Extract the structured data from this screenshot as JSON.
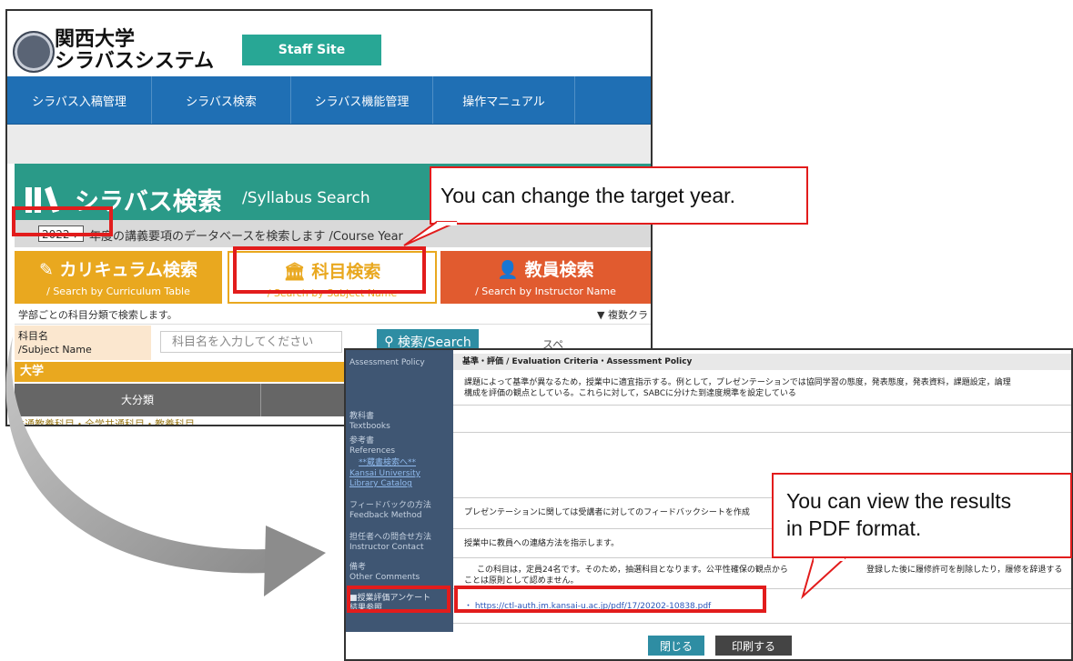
{
  "system": {
    "logo_line1": "関西大学",
    "logo_line2": "シラバスシステム",
    "staff_site_label": "Staff Site"
  },
  "nav": {
    "items": [
      {
        "label": "シラバス入稿管理"
      },
      {
        "label": "シラバス検索"
      },
      {
        "label": "シラバス機能管理"
      },
      {
        "label": "操作マニュアル"
      }
    ]
  },
  "header": {
    "title_jp": "シラバス検索",
    "title_en": "/Syllabus Search"
  },
  "year": {
    "selected": "2022",
    "caption": "年度の講義要項のデータベースを検索します /Course Year"
  },
  "tabs": [
    {
      "jp": "カリキュラム検索",
      "en": "/ Search by Curriculum Table"
    },
    {
      "jp": "科目検索",
      "en": "/ Search by Subject Name"
    },
    {
      "jp": "教員検索",
      "en": "/ Search by Instructor Name"
    }
  ],
  "search": {
    "description": "学部ごとの科目分類で検索します。",
    "multi_class_label": "▼ 複数クラ",
    "subject_label_jp": "科目名",
    "subject_label_en": "/Subject Name",
    "placeholder": "科目名を入力してください",
    "button_label": "検索/Search",
    "trailing_text": "スペ"
  },
  "results": {
    "section": "大学",
    "column_header": "大分類",
    "first_row": "共通教養科目・全学共通科目・教養科目"
  },
  "detail": {
    "rows": [
      {
        "left": "Assessment Policy",
        "right": ""
      },
      {
        "left": "教科書\nTextbooks",
        "right": ""
      },
      {
        "left": "参考書\nReferences",
        "right": ""
      },
      {
        "left": "フィードバックの方法\nFeedback Method",
        "right": "プレゼンテーションに関しては受講者に対してのフィードバックシートを作成"
      },
      {
        "left": "担任者への問合せ方法\nInstructor Contact",
        "right": "授業中に教員への連絡方法を指示します。"
      },
      {
        "left": "備考\nOther Comments",
        "right": ""
      },
      {
        "left": "■授業評価アンケート\n結果参照",
        "right": ""
      }
    ],
    "criteria_header": "基準・評価 / Evaluation Criteria・Assessment Policy",
    "criteria_text1": "課題によって基準が異なるため，授業中に適宜指示する。例として，プレゼンテーションでは協同学習の態度，発表態度，発表資料，課題設定，論理",
    "criteria_text2": "構成を評価の観点としている。これらに対して，SABCに分けた到達度規準を設定している",
    "library_search": "**蔵書検索へ**",
    "library_catalog1": "Kansai University",
    "library_catalog2": "Library Catalog",
    "comments_text1": "この科目は，定員24名です。そのため，抽選科目となります。公平性確保の観点から",
    "comments_text2": "登録した後に履修許可を削除したり，履修を辞退する",
    "comments_text3": "ことは原則として認めません。",
    "pdf_url": "・ https://ctl-auth.jm.kansai-u.ac.jp/pdf/17/20202-10838.pdf",
    "close_label": "閉じる",
    "print_label": "印刷する"
  },
  "annotations": {
    "year_callout": "You can change the target year.",
    "pdf_callout_line1": "You can view the results",
    "pdf_callout_line2": "in PDF format.",
    "accent_color": "#e21c1c"
  }
}
